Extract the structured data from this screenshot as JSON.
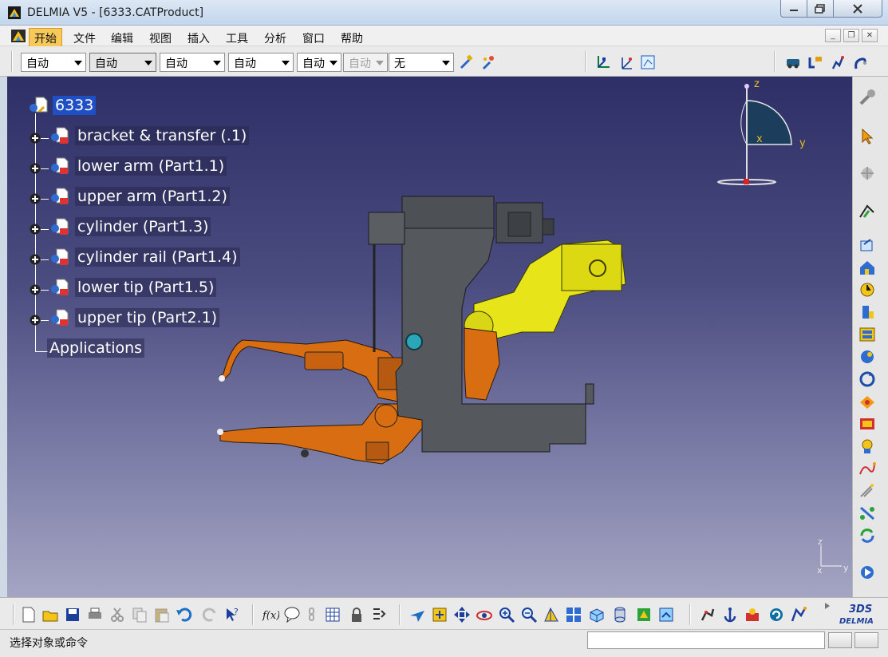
{
  "window": {
    "title": "DELMIA V5 - [6333.CATProduct]",
    "controls": [
      "minimize",
      "maximize",
      "close"
    ]
  },
  "menu": {
    "items": [
      "开始",
      "文件",
      "编辑",
      "视图",
      "插入",
      "工具",
      "分析",
      "窗口",
      "帮助"
    ]
  },
  "toolbar_top": {
    "combos": [
      {
        "value": "自动",
        "state": "normal"
      },
      {
        "value": "自动",
        "state": "sunken"
      },
      {
        "value": "自动",
        "state": "normal"
      },
      {
        "value": "自动",
        "state": "normal"
      },
      {
        "value": "自动",
        "state": "normal"
      },
      {
        "value": "自动",
        "state": "disabled"
      },
      {
        "value": "无",
        "state": "normal"
      }
    ]
  },
  "tree": {
    "root": "6333",
    "children": [
      "bracket & transfer (.1)",
      "lower arm (Part1.1)",
      "upper arm (Part1.2)",
      "cylinder (Part1.3)",
      "cylinder rail (Part1.4)",
      "lower tip (Part1.5)",
      "upper tip (Part2.1)"
    ],
    "applications": "Applications"
  },
  "compass": {
    "z": "z",
    "x": "x",
    "y": "y"
  },
  "mini_axis": {
    "z": "z",
    "x": "x",
    "y": "y"
  },
  "colors": {
    "arm_orange": "#d86d12",
    "body_gray": "#55585c",
    "cylinder_yellow": "#e7e51a",
    "tree_selected": "#1f4fc4"
  },
  "statusbar": {
    "prompt": "选择对象或命令",
    "command_value": ""
  },
  "brand": {
    "logo_text": "DELMIA",
    "ds": "3DS"
  }
}
